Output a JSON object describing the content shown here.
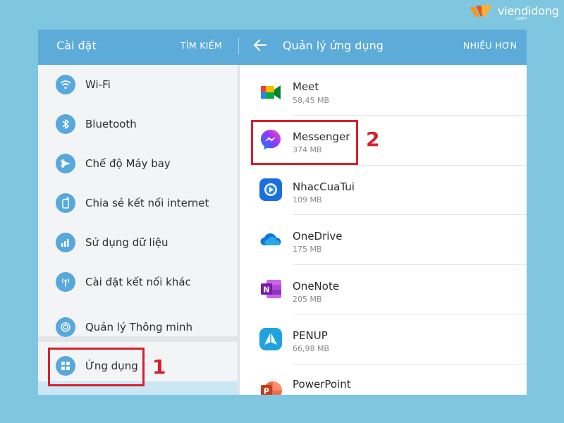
{
  "brand": {
    "name": "viendidong",
    "sub": ".com",
    "icon": "viendidong-logo-icon"
  },
  "left_header": {
    "title": "Cài đặt",
    "search_label": "TÌM KIẾM"
  },
  "right_header": {
    "back_icon": "back-arrow-icon",
    "title": "Quản lý ứng dụng",
    "more_label": "NHIỀU HƠN"
  },
  "settings": {
    "items": [
      {
        "label": "Wi-Fi",
        "icon": "wifi-icon"
      },
      {
        "label": "Bluetooth",
        "icon": "bluetooth-icon"
      },
      {
        "label": "Chế độ Máy bay",
        "icon": "airplane-icon"
      },
      {
        "label": "Chia sẻ kết nối internet",
        "icon": "tethering-icon"
      },
      {
        "label": "Sử dụng dữ liệu",
        "icon": "data-usage-icon"
      },
      {
        "label": "Cài đặt kết nối khác",
        "icon": "more-connections-icon"
      },
      {
        "label": "Quản lý Thông minh",
        "icon": "smart-manager-icon"
      },
      {
        "label": "Ứng dụng",
        "icon": "apps-icon",
        "selected": true
      }
    ]
  },
  "apps": {
    "items": [
      {
        "name": "Meet",
        "size": "58,45 MB",
        "icon": "meet-icon"
      },
      {
        "name": "Messenger",
        "size": "374 MB",
        "icon": "messenger-icon"
      },
      {
        "name": "NhacCuaTui",
        "size": "109 MB",
        "icon": "nhaccuatui-icon"
      },
      {
        "name": "OneDrive",
        "size": "175 MB",
        "icon": "onedrive-icon"
      },
      {
        "name": "OneNote",
        "size": "205 MB",
        "icon": "onenote-icon"
      },
      {
        "name": "PENUP",
        "size": "66,98 MB",
        "icon": "penup-icon"
      },
      {
        "name": "PowerPoint",
        "size": "",
        "icon": "powerpoint-icon"
      }
    ]
  },
  "annotations": {
    "step1": "1",
    "step2": "2"
  },
  "colors": {
    "header": "#5cabd8",
    "accent_icon": "#57a8dc",
    "selected": "#cbe6f5",
    "annotation": "#d5212f",
    "background": "#7fc6e1"
  }
}
